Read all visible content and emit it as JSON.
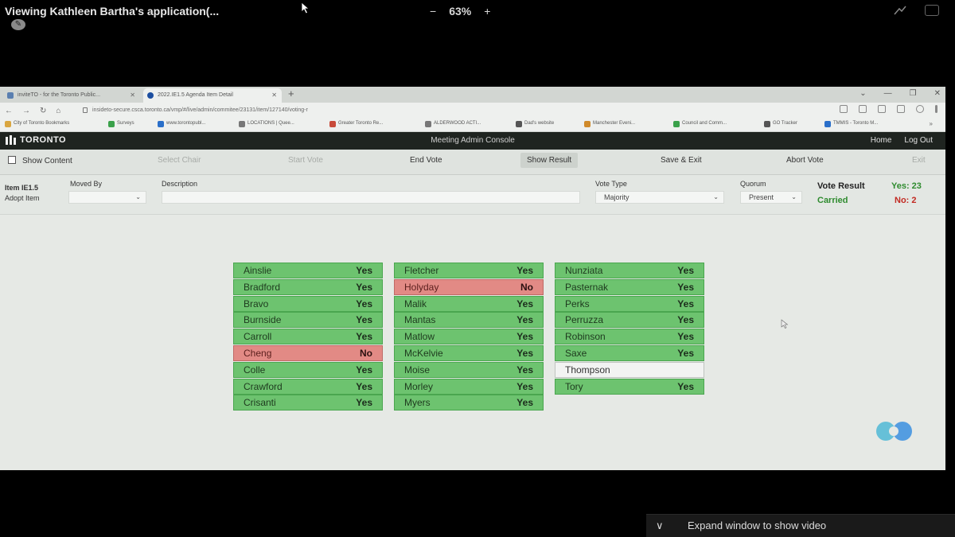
{
  "viewer": {
    "title": "Viewing Kathleen Bartha's application(...",
    "zoom_out": "−",
    "zoom_level": "63%",
    "zoom_in": "+"
  },
  "browser": {
    "tabs": [
      {
        "label": "inviteTO - for the Toronto Public..."
      },
      {
        "label": "2022.IE1.5 Agenda Item Detail"
      }
    ],
    "new_tab": "+",
    "url": "insideto-secure.csca.toronto.ca/vmp/#/live/admin/commitee/23131/item/127140/voting-r",
    "bookmarks": [
      {
        "label": "City of Toronto Bookmarks",
        "color": "#d9a640"
      },
      {
        "label": "Surveys",
        "color": "#3aa14a"
      },
      {
        "label": "www.torontopubl...",
        "color": "#2a6fc9"
      },
      {
        "label": "LOCATIONS | Quee...",
        "color": "#777777"
      },
      {
        "label": "Greater Toronto Re...",
        "color": "#c84a3a"
      },
      {
        "label": "ALDERWOOD ACTI...",
        "color": "#777777"
      },
      {
        "label": "Dad's website",
        "color": "#555555"
      },
      {
        "label": "Manchester Eveni...",
        "color": "#d08a2a"
      },
      {
        "label": "Council and Comm...",
        "color": "#3aa14a"
      },
      {
        "label": "GO Tracker",
        "color": "#555555"
      },
      {
        "label": "TMMIS - Toronto M...",
        "color": "#2a6fc9"
      }
    ],
    "bookmarks_more": "»"
  },
  "app": {
    "logo": "TORONTO",
    "title": "Meeting Admin Console",
    "home": "Home",
    "logout": "Log Out"
  },
  "toolbar": {
    "show_content": "Show Content",
    "select_chair": "Select Chair",
    "start_vote": "Start Vote",
    "end_vote": "End Vote",
    "show_result": "Show Result",
    "save_exit": "Save & Exit",
    "abort_vote": "Abort Vote",
    "exit": "Exit"
  },
  "form": {
    "item_label": "Item IE1.5",
    "item_desc": "Adopt Item",
    "moved_by_label": "Moved By",
    "moved_by_value": "",
    "description_label": "Description",
    "description_value": "",
    "vote_type_label": "Vote Type",
    "vote_type_value": "Majority",
    "quorum_label": "Quorum",
    "quorum_value": "Present"
  },
  "result": {
    "title": "Vote Result",
    "status": "Carried",
    "yes": "Yes: 23",
    "no": "No: 2",
    "status_color": "#2e8b2e",
    "no_color": "#c22a22"
  },
  "votes": {
    "col1": [
      {
        "name": "Ainslie",
        "vote": "Yes"
      },
      {
        "name": "Bradford",
        "vote": "Yes"
      },
      {
        "name": "Bravo",
        "vote": "Yes"
      },
      {
        "name": "Burnside",
        "vote": "Yes"
      },
      {
        "name": "Carroll",
        "vote": "Yes"
      },
      {
        "name": "Cheng",
        "vote": "No"
      },
      {
        "name": "Colle",
        "vote": "Yes"
      },
      {
        "name": "Crawford",
        "vote": "Yes"
      },
      {
        "name": "Crisanti",
        "vote": "Yes"
      }
    ],
    "col2": [
      {
        "name": "Fletcher",
        "vote": "Yes"
      },
      {
        "name": "Holyday",
        "vote": "No"
      },
      {
        "name": "Malik",
        "vote": "Yes"
      },
      {
        "name": "Mantas",
        "vote": "Yes"
      },
      {
        "name": "Matlow",
        "vote": "Yes"
      },
      {
        "name": "McKelvie",
        "vote": "Yes"
      },
      {
        "name": "Moise",
        "vote": "Yes"
      },
      {
        "name": "Morley",
        "vote": "Yes"
      },
      {
        "name": "Myers",
        "vote": "Yes"
      }
    ],
    "col3": [
      {
        "name": "Nunziata",
        "vote": "Yes"
      },
      {
        "name": "Pasternak",
        "vote": "Yes"
      },
      {
        "name": "Perks",
        "vote": "Yes"
      },
      {
        "name": "Perruzza",
        "vote": "Yes"
      },
      {
        "name": "Robinson",
        "vote": "Yes"
      },
      {
        "name": "Saxe",
        "vote": "Yes"
      },
      {
        "name": "Thompson",
        "vote": ""
      },
      {
        "name": "Tory",
        "vote": "Yes"
      }
    ]
  },
  "footer": {
    "chevron": "∨",
    "expand_text": "Expand window to show video"
  }
}
